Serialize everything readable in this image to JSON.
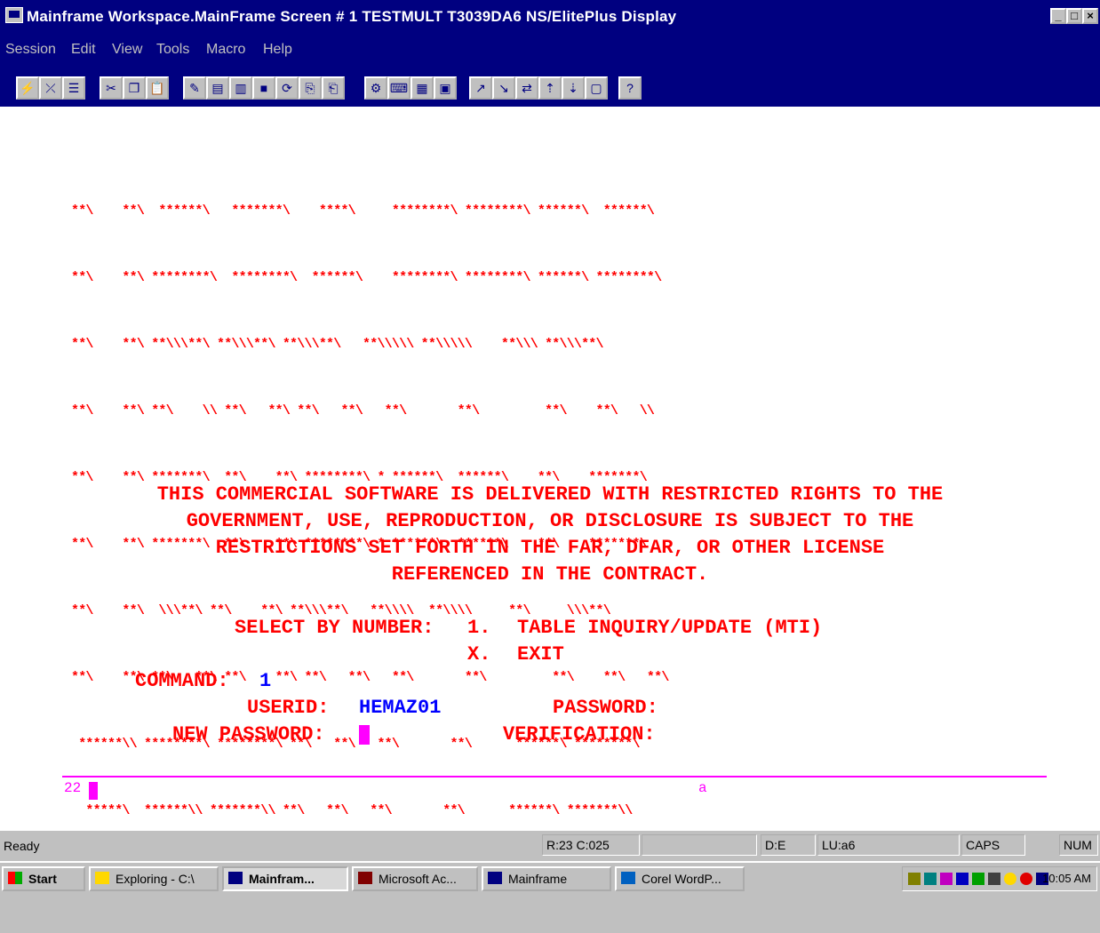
{
  "window": {
    "title": "Mainframe Workspace.MainFrame Screen # 1   TESTMULT   T3039DA6   NS/ElitePlus Display",
    "controls": [
      "_",
      "□",
      "×"
    ]
  },
  "menu": [
    "Session",
    "Edit",
    "View",
    "Tools",
    "Macro",
    "Help"
  ],
  "toolbar_icons": [
    "connect-icon",
    "disconnect-icon",
    "properties-icon",
    "cut-icon",
    "copy-icon",
    "paste-icon",
    "edit-icon",
    "print-icon",
    "print-setup-icon",
    "stop-icon",
    "reset-icon",
    "copy-screen-icon",
    "paste-screen-icon",
    "macro-icon",
    "keyboard-icon",
    "keypad-icon",
    "settings-icon",
    "send-file-icon",
    "receive-file-icon",
    "transfer-icon",
    "upload-icon",
    "download-icon",
    "capture-icon",
    "help-icon"
  ],
  "screen": {
    "banner_art": [
      "**\\    **\\  ******\\   *******\\    ****\\     ********\\ ********\\ ******\\  ******\\",
      "**\\    **\\ ********\\  ********\\  ******\\    ********\\ ********\\ ******\\ ********\\",
      "**\\    **\\ **\\\\\\**\\ **\\\\\\**\\ **\\\\\\**\\   **\\\\\\\\\\ **\\\\\\\\\\    **\\\\\\ **\\\\\\**\\",
      "**\\    **\\ **\\    \\\\ **\\   **\\ **\\   **\\   **\\       **\\         **\\    **\\   \\\\",
      "**\\    **\\ *******\\  **\\    **\\ ********\\ * ******\\  ******\\    **\\    *******\\",
      "**\\    **\\ *******\\  **\\    **\\ ********\\ * ******\\  ******\\    **\\    *******\\",
      "**\\    **\\  \\\\\\**\\ **\\    **\\ **\\\\\\**\\   **\\\\\\\\  **\\\\\\\\     **\\     \\\\\\**\\",
      "**\\    **\\ **\\   **\\ **\\    **\\ **\\   **\\   **\\       **\\         **\\    **\\   **\\",
      " ******\\\\ ********\\ ********\\ **\\   **\\   **\\       **\\      ******\\ ********\\",
      "  *****\\  ******\\\\ *******\\\\ **\\   **\\   **\\       **\\      ******\\ *******\\\\",
      "   \\\\\\\\   \\\\\\\\\\\\   \\\\\\\\\\\\\\  \\\\    \\\\    \\\\        \\\\       \\\\\\\\\\\\  \\\\\\\\\\\\"
    ],
    "notice_lines": [
      "THIS COMMERCIAL SOFTWARE IS DELIVERED WITH RESTRICTED RIGHTS TO THE",
      "GOVERNMENT, USE, REPRODUCTION, OR DISCLOSURE IS SUBJECT TO THE",
      "RESTRICTIONS SET FORTH IN THE FAR, DFAR, OR OTHER LICENSE",
      "REFERENCED IN THE CONTRACT."
    ],
    "select_label": "SELECT BY NUMBER:",
    "options": [
      {
        "key": "1.",
        "label": "TABLE INQUIRY/UPDATE (MTI)"
      },
      {
        "key": "X.",
        "label": "EXIT"
      }
    ],
    "command_label": "COMMAND:",
    "command_value": "1",
    "userid_label": "USERID:",
    "userid_value": "HEMAZ01",
    "password_label": "PASSWORD:",
    "new_password_label": "NEW PASSWORD:",
    "verification_label": "VERIFICATION:",
    "oia_left": "22",
    "oia_mid": "a"
  },
  "statusbar": {
    "left": "Ready",
    "cursor_pos": "R:23 C:025",
    "panel_de": "D:E",
    "panel_lu": "LU:a6",
    "caps": "CAPS",
    "num": "NUM"
  },
  "taskbar": {
    "start": "Start",
    "tasks": [
      "Exploring - C:\\",
      "Mainfram...",
      "Microsoft Ac...",
      "Mainframe",
      "Corel WordP..."
    ],
    "clock": "10:05 AM"
  }
}
